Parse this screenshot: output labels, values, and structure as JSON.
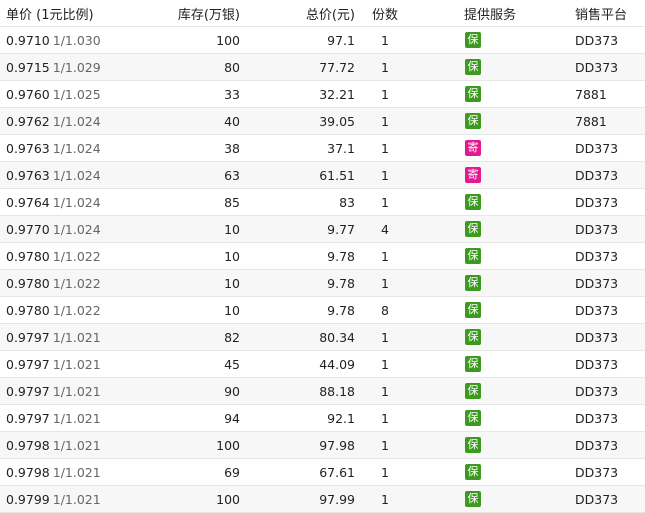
{
  "colors": {
    "bao": "#3c9a1f",
    "ji": "#e3198f"
  },
  "headers": {
    "unit_price": "单价 (1元比例)",
    "stock": "库存(万银)",
    "total": "总价(元)",
    "count": "份数",
    "service": "提供服务",
    "platform": "销售平台"
  },
  "rows": [
    {
      "price": "0.9710",
      "ratio": "1/1.030",
      "stock": "100",
      "total": "97.1",
      "count": "1",
      "service": "保",
      "platform": "DD373"
    },
    {
      "price": "0.9715",
      "ratio": "1/1.029",
      "stock": "80",
      "total": "77.72",
      "count": "1",
      "service": "保",
      "platform": "DD373"
    },
    {
      "price": "0.9760",
      "ratio": "1/1.025",
      "stock": "33",
      "total": "32.21",
      "count": "1",
      "service": "保",
      "platform": "7881"
    },
    {
      "price": "0.9762",
      "ratio": "1/1.024",
      "stock": "40",
      "total": "39.05",
      "count": "1",
      "service": "保",
      "platform": "7881"
    },
    {
      "price": "0.9763",
      "ratio": "1/1.024",
      "stock": "38",
      "total": "37.1",
      "count": "1",
      "service": "寄",
      "platform": "DD373"
    },
    {
      "price": "0.9763",
      "ratio": "1/1.024",
      "stock": "63",
      "total": "61.51",
      "count": "1",
      "service": "寄",
      "platform": "DD373"
    },
    {
      "price": "0.9764",
      "ratio": "1/1.024",
      "stock": "85",
      "total": "83",
      "count": "1",
      "service": "保",
      "platform": "DD373"
    },
    {
      "price": "0.9770",
      "ratio": "1/1.024",
      "stock": "10",
      "total": "9.77",
      "count": "4",
      "service": "保",
      "platform": "DD373"
    },
    {
      "price": "0.9780",
      "ratio": "1/1.022",
      "stock": "10",
      "total": "9.78",
      "count": "1",
      "service": "保",
      "platform": "DD373"
    },
    {
      "price": "0.9780",
      "ratio": "1/1.022",
      "stock": "10",
      "total": "9.78",
      "count": "1",
      "service": "保",
      "platform": "DD373"
    },
    {
      "price": "0.9780",
      "ratio": "1/1.022",
      "stock": "10",
      "total": "9.78",
      "count": "8",
      "service": "保",
      "platform": "DD373"
    },
    {
      "price": "0.9797",
      "ratio": "1/1.021",
      "stock": "82",
      "total": "80.34",
      "count": "1",
      "service": "保",
      "platform": "DD373"
    },
    {
      "price": "0.9797",
      "ratio": "1/1.021",
      "stock": "45",
      "total": "44.09",
      "count": "1",
      "service": "保",
      "platform": "DD373"
    },
    {
      "price": "0.9797",
      "ratio": "1/1.021",
      "stock": "90",
      "total": "88.18",
      "count": "1",
      "service": "保",
      "platform": "DD373"
    },
    {
      "price": "0.9797",
      "ratio": "1/1.021",
      "stock": "94",
      "total": "92.1",
      "count": "1",
      "service": "保",
      "platform": "DD373"
    },
    {
      "price": "0.9798",
      "ratio": "1/1.021",
      "stock": "100",
      "total": "97.98",
      "count": "1",
      "service": "保",
      "platform": "DD373"
    },
    {
      "price": "0.9798",
      "ratio": "1/1.021",
      "stock": "69",
      "total": "67.61",
      "count": "1",
      "service": "保",
      "platform": "DD373"
    },
    {
      "price": "0.9799",
      "ratio": "1/1.021",
      "stock": "100",
      "total": "97.99",
      "count": "1",
      "service": "保",
      "platform": "DD373"
    }
  ]
}
